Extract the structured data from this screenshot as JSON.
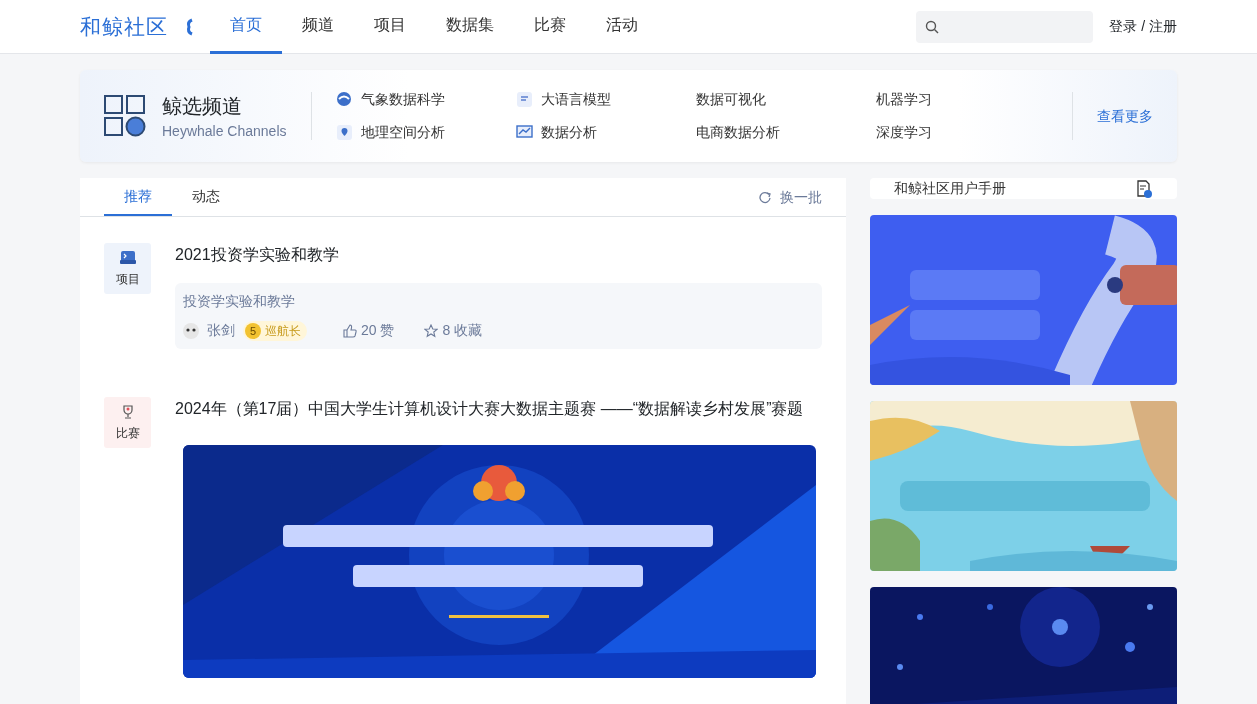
{
  "header": {
    "logo": "和鲸社区",
    "nav": [
      {
        "label": "首页",
        "selected": true
      },
      {
        "label": "频道",
        "selected": false
      },
      {
        "label": "项目",
        "selected": false
      },
      {
        "label": "数据集",
        "selected": false
      },
      {
        "label": "比赛",
        "selected": false
      },
      {
        "label": "活动",
        "selected": false
      }
    ],
    "auth": "登录 / 注册"
  },
  "channels": {
    "title": "鲸选频道",
    "subtitle": "Heywhale Channels",
    "items": [
      {
        "label": "气象数据科学",
        "kind": "with-icon"
      },
      {
        "label": "大语言模型",
        "kind": "with-icon"
      },
      {
        "label": "数据可视化",
        "kind": "plain"
      },
      {
        "label": "机器学习",
        "kind": "plain"
      },
      {
        "label": "地理空间分析",
        "kind": "with-icon"
      },
      {
        "label": "数据分析",
        "kind": "with-icon"
      },
      {
        "label": "电商数据分析",
        "kind": "plain"
      },
      {
        "label": "深度学习",
        "kind": "plain"
      }
    ],
    "more": "查看更多"
  },
  "feed": {
    "tabs": [
      {
        "label": "推荐",
        "selected": true
      },
      {
        "label": "动态",
        "selected": false
      }
    ],
    "refresh": "换一批",
    "items": [
      {
        "kind": "project",
        "type_label": "项目",
        "title": "2021投资学实验和教学",
        "summary": "投资学实验和教学",
        "author": "张剑",
        "level_badge": "5",
        "level_name": "巡航长",
        "likes": "20 赞",
        "favorites": "8 收藏"
      },
      {
        "kind": "competition",
        "type_label": "比赛",
        "title": "2024年（第17届）中国大学生计算机设计大赛大数据主题赛 ——“数据解读乡村发展”赛题"
      }
    ]
  },
  "sidebar": {
    "manual": "和鲸社区用户手册"
  }
}
